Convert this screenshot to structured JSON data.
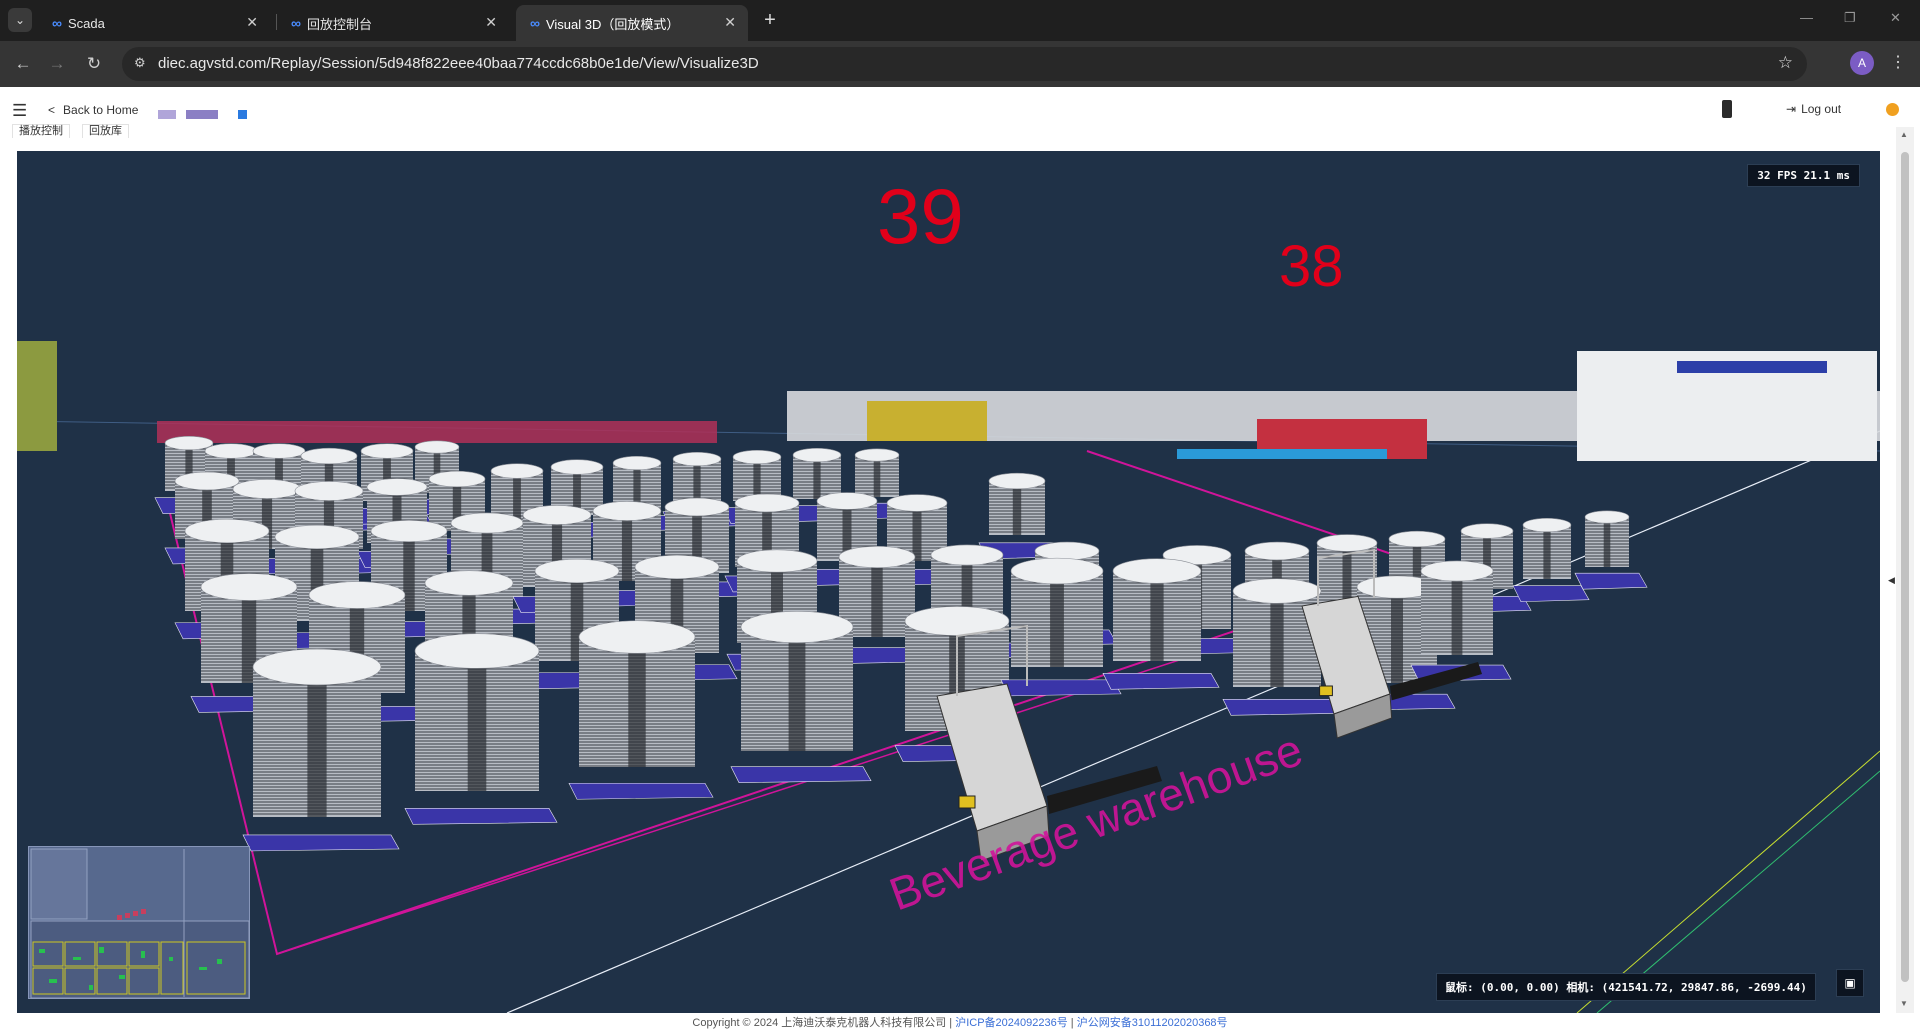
{
  "browser": {
    "tabs": [
      {
        "label": "Scada",
        "active": false
      },
      {
        "label": "回放控制台",
        "active": false
      },
      {
        "label": "Visual 3D（回放模式）",
        "active": true
      }
    ],
    "url": "diec.agvstd.com/Replay/Session/5d948f822eee40baa774ccdc68b0e1de/View/Visualize3D",
    "profile_initial": "A"
  },
  "header": {
    "back_label": "Back to Home",
    "subtabs": [
      "播放控制",
      "回放库"
    ],
    "logout_label": "Log out"
  },
  "viewport": {
    "fps_label": "32 FPS  21.1 ms",
    "zone_numbers": [
      "39",
      "38"
    ],
    "floor_text": "Beverage warehouse",
    "status_line": "鼠标: (0.00, 0.00)  相机: (421541.72, 29847.86, -2699.44)",
    "colors": {
      "background": "#1f3147",
      "zone_label": "#e1001a",
      "floor_marking": "#d0149a",
      "pallet": "#3a35a8"
    }
  },
  "footer": {
    "copyright": "Copyright © 2024 上海迪沃泰克机器人科技有限公司 | ",
    "icp": "沪ICP备2024092236号",
    "sep": " | ",
    "police": "沪公网安备31011202020368号"
  }
}
